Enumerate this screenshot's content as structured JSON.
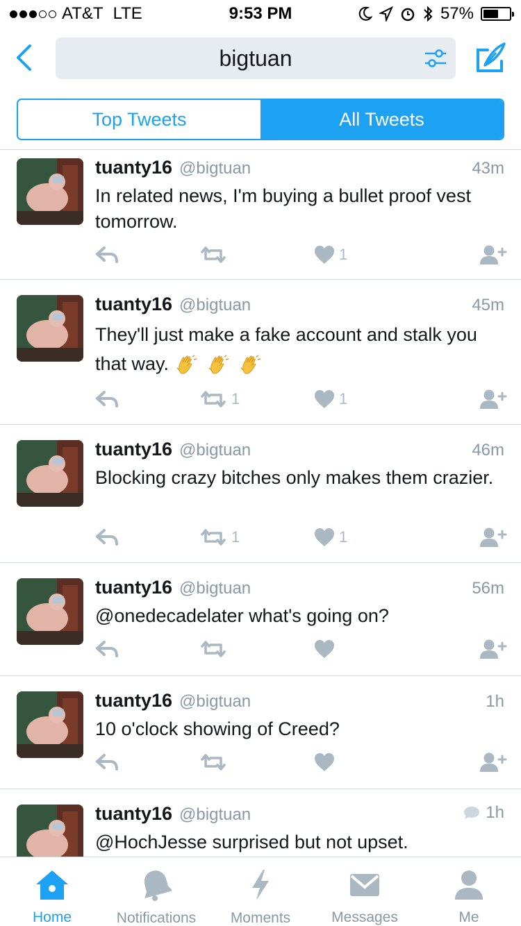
{
  "status_bar": {
    "carrier": "AT&T",
    "network": "LTE",
    "time": "9:53 PM",
    "battery": "57%",
    "battery_level": 0.57,
    "signal_bars": 3
  },
  "header": {
    "search_query": "bigtuan"
  },
  "tabs": {
    "top": "Top Tweets",
    "all": "All Tweets",
    "active": "all"
  },
  "tweets": [
    {
      "name": "tuanty16",
      "handle": "@bigtuan",
      "time": "43m",
      "text": "In related news, I'm buying a bullet proof vest tomorrow.",
      "retweets": "",
      "likes": "1"
    },
    {
      "name": "tuanty16",
      "handle": "@bigtuan",
      "time": "45m",
      "text": "They'll just make a fake account and stalk you that way.",
      "retweets": "1",
      "likes": "1"
    },
    {
      "name": "tuanty16",
      "handle": "@bigtuan",
      "time": "46m",
      "text": "Blocking crazy bitches only makes them crazier.",
      "retweets": "1",
      "likes": "1"
    },
    {
      "name": "tuanty16",
      "handle": "@bigtuan",
      "time": "56m",
      "text": "@onedecadelater what's going on?",
      "retweets": "",
      "likes": ""
    },
    {
      "name": "tuanty16",
      "handle": "@bigtuan",
      "time": "1h",
      "text": "10 o'clock showing of Creed?",
      "retweets": "",
      "likes": ""
    },
    {
      "name": "tuanty16",
      "handle": "@bigtuan",
      "time": "1h",
      "text": "@HochJesse surprised but not upset.",
      "retweets": "",
      "likes": ""
    }
  ],
  "tab_bar": {
    "home": "Home",
    "notifications": "Notifications",
    "moments": "Moments",
    "messages": "Messages",
    "me": "Me"
  },
  "colors": {
    "accent": "#1da1f2",
    "muted": "#8899a6",
    "icon_gray": "#aab8c2"
  }
}
